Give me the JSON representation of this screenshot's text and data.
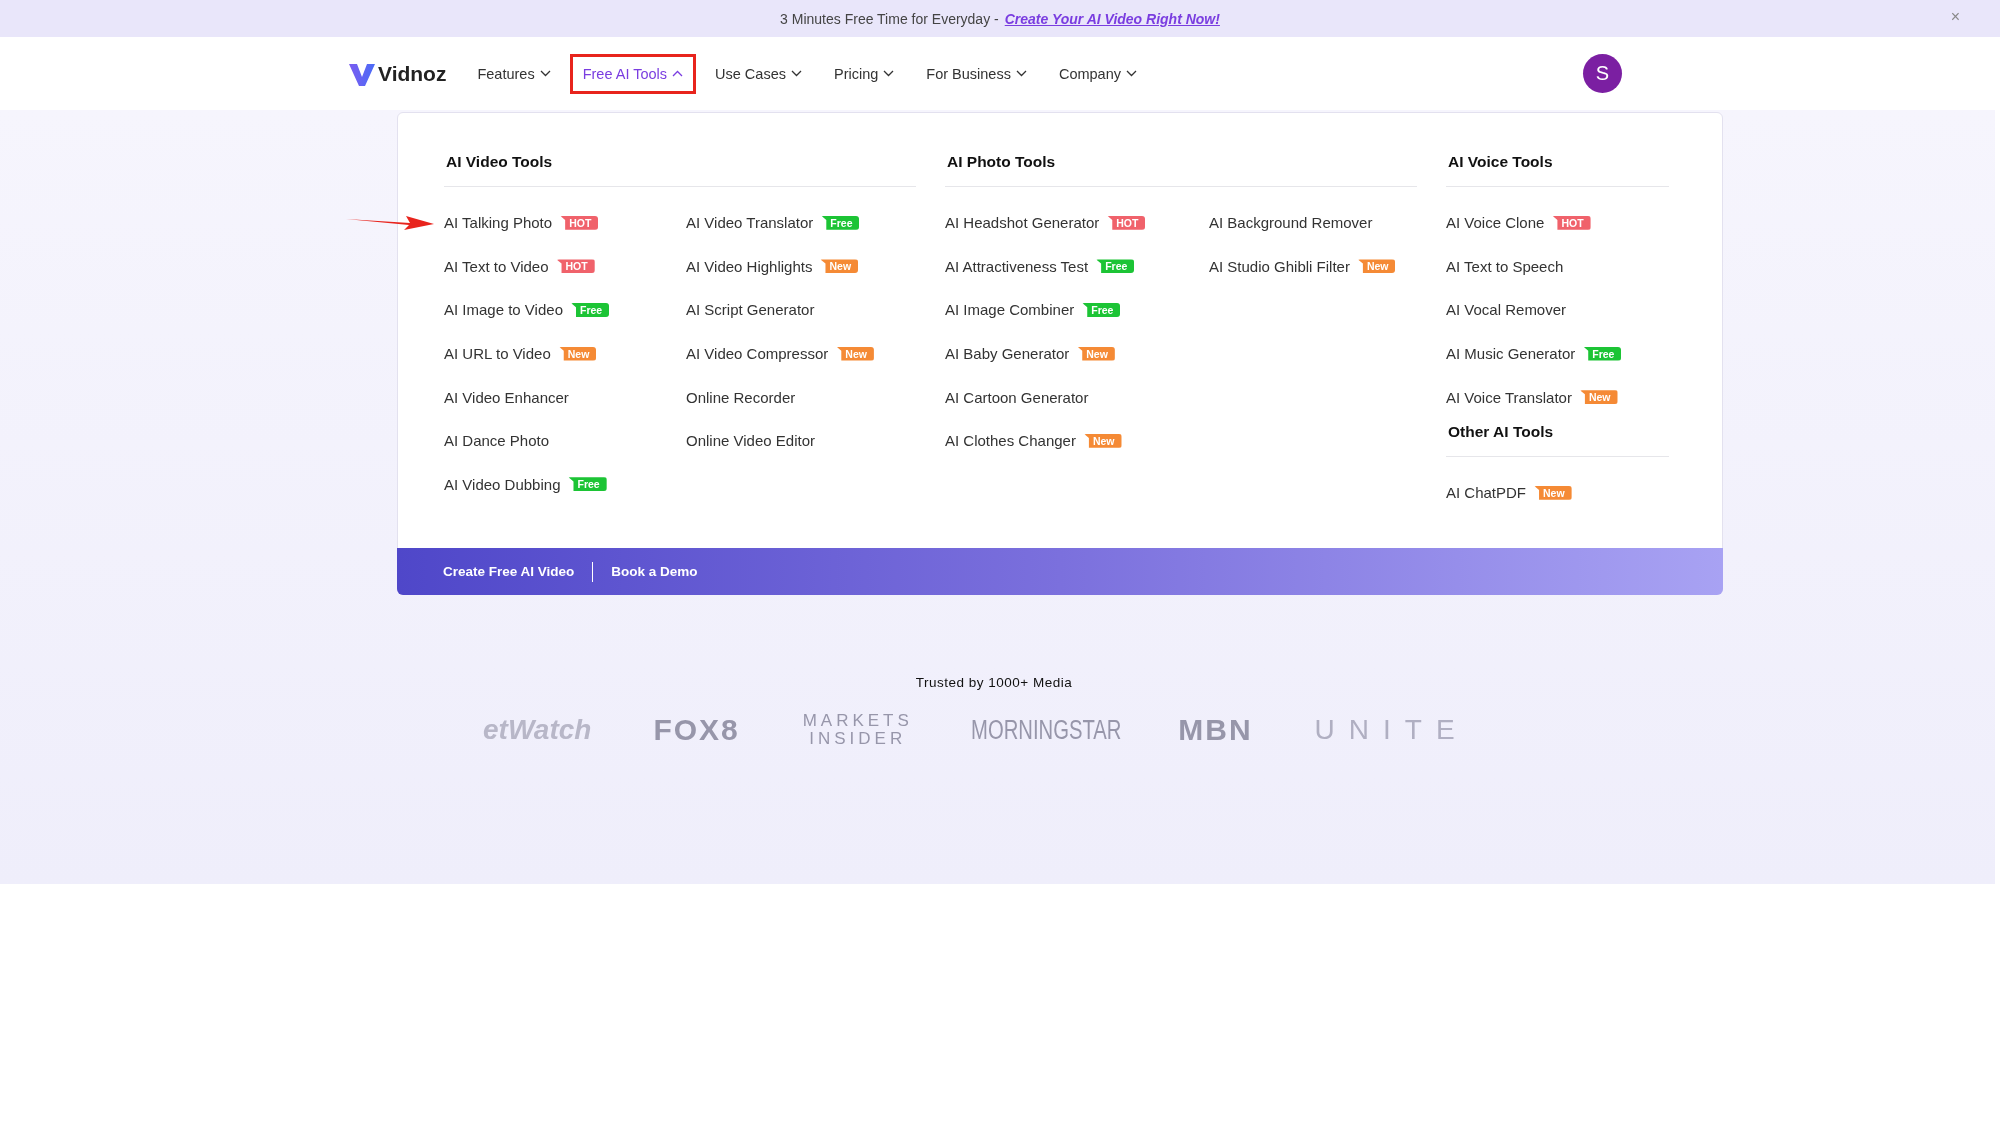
{
  "banner": {
    "text": "3 Minutes Free Time for Everyday -",
    "link": "Create Your AI Video Right Now!",
    "close": "×"
  },
  "logo": {
    "text": "Vidnoz"
  },
  "nav": [
    {
      "label": "Features",
      "selected": false,
      "highlighted": false
    },
    {
      "label": "Free AI Tools",
      "selected": true,
      "highlighted": true
    },
    {
      "label": "Use Cases",
      "selected": false,
      "highlighted": false
    },
    {
      "label": "Pricing",
      "selected": false,
      "highlighted": false
    },
    {
      "label": "For Business",
      "selected": false,
      "highlighted": false
    },
    {
      "label": "Company",
      "selected": false,
      "highlighted": false
    }
  ],
  "avatar": {
    "initial": "S"
  },
  "menu": {
    "columns": [
      {
        "sections": [
          {
            "title": "AI Video Tools",
            "lists": [
              [
                {
                  "label": "AI Talking Photo",
                  "badge": {
                    "kind": "hot",
                    "text": "HOT"
                  },
                  "pointed": true
                },
                {
                  "label": "AI Text to Video",
                  "badge": {
                    "kind": "hot",
                    "text": "HOT"
                  }
                },
                {
                  "label": "AI Image to Video",
                  "badge": {
                    "kind": "free",
                    "text": "Free"
                  }
                },
                {
                  "label": "AI URL to Video",
                  "badge": {
                    "kind": "new",
                    "text": "New"
                  }
                },
                {
                  "label": "AI Video Enhancer"
                },
                {
                  "label": "AI Dance Photo"
                },
                {
                  "label": "AI Video Dubbing",
                  "badge": {
                    "kind": "free",
                    "text": "Free"
                  }
                }
              ],
              [
                {
                  "label": "AI Video Translator",
                  "badge": {
                    "kind": "free",
                    "text": "Free"
                  }
                },
                {
                  "label": "AI Video Highlights",
                  "badge": {
                    "kind": "new",
                    "text": "New"
                  }
                },
                {
                  "label": "AI Script Generator"
                },
                {
                  "label": "AI Video Compressor",
                  "badge": {
                    "kind": "new",
                    "text": "New"
                  }
                },
                {
                  "label": "Online Recorder"
                },
                {
                  "label": "Online Video Editor"
                }
              ]
            ]
          }
        ]
      },
      {
        "sections": [
          {
            "title": "AI Photo Tools",
            "lists": [
              [
                {
                  "label": "AI Headshot Generator",
                  "badge": {
                    "kind": "hot",
                    "text": "HOT"
                  }
                },
                {
                  "label": "AI Attractiveness Test",
                  "badge": {
                    "kind": "free",
                    "text": "Free"
                  }
                },
                {
                  "label": "AI Image Combiner",
                  "badge": {
                    "kind": "free",
                    "text": "Free"
                  }
                },
                {
                  "label": "AI Baby Generator",
                  "badge": {
                    "kind": "new",
                    "text": "New"
                  }
                },
                {
                  "label": "AI Cartoon Generator"
                },
                {
                  "label": "AI Clothes Changer",
                  "badge": {
                    "kind": "new",
                    "text": "New"
                  }
                }
              ],
              [
                {
                  "label": "AI Background Remover"
                },
                {
                  "label": "AI Studio Ghibli Filter",
                  "badge": {
                    "kind": "new",
                    "text": "New"
                  }
                }
              ]
            ]
          }
        ]
      },
      {
        "sections": [
          {
            "title": "AI Voice Tools",
            "lists": [
              [
                {
                  "label": "AI Voice Clone",
                  "badge": {
                    "kind": "hot",
                    "text": "HOT"
                  }
                },
                {
                  "label": "AI Text to Speech"
                },
                {
                  "label": "AI Vocal Remover"
                },
                {
                  "label": "AI Music Generator",
                  "badge": {
                    "kind": "free",
                    "text": "Free"
                  }
                },
                {
                  "label": "AI Voice Translator",
                  "badge": {
                    "kind": "new",
                    "text": "New"
                  }
                }
              ]
            ]
          },
          {
            "title": "Other AI Tools",
            "lists": [
              [
                {
                  "label": "AI ChatPDF",
                  "badge": {
                    "kind": "new",
                    "text": "New"
                  }
                }
              ]
            ]
          }
        ]
      }
    ],
    "footer_links": [
      "Create Free AI Video",
      "Book a Demo"
    ]
  },
  "trusted": {
    "title": "Trusted by 1000+ Media",
    "logos": [
      {
        "kind": "italic",
        "text": "etWatch"
      },
      {
        "kind": "heavy",
        "text": "FOX8"
      },
      {
        "kind": "stacked",
        "text": "MARKETS INSIDER"
      },
      {
        "kind": "condensed",
        "text": "MORNINGSTAR"
      },
      {
        "kind": "heavy",
        "text": "MBN"
      },
      {
        "kind": "thin",
        "text": "UNITE"
      }
    ]
  }
}
